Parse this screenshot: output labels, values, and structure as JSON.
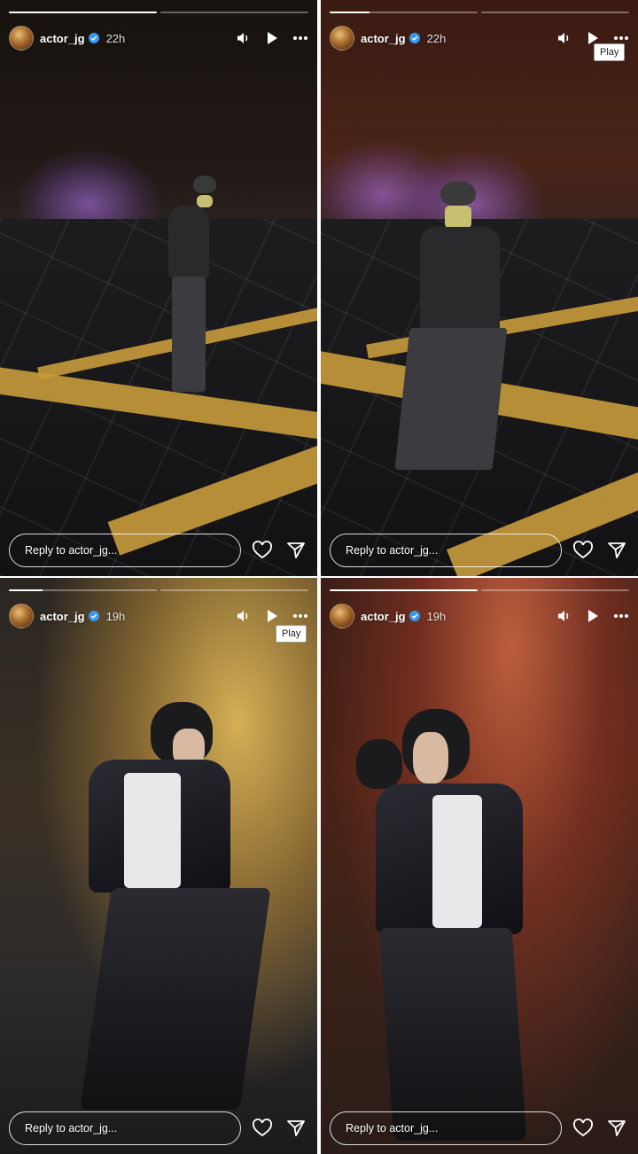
{
  "stories": [
    {
      "username": "actor_jg",
      "time": "22h",
      "reply_placeholder": "Reply to actor_jg...",
      "progress": [
        1.0,
        0.0
      ],
      "tooltip": null
    },
    {
      "username": "actor_jg",
      "time": "22h",
      "reply_placeholder": "Reply to actor_jg...",
      "progress": [
        0.27,
        0.0
      ],
      "tooltip": "Play"
    },
    {
      "username": "actor_jg",
      "time": "19h",
      "reply_placeholder": "Reply to actor_jg...",
      "progress": [
        0.23,
        0.0
      ],
      "tooltip": "Play"
    },
    {
      "username": "actor_jg",
      "time": "19h",
      "reply_placeholder": "Reply to actor_jg...",
      "progress": [
        1.0,
        0.0
      ],
      "tooltip": null
    }
  ],
  "icons": {
    "mute": "speaker-icon",
    "play": "play-icon",
    "more": "more-icon",
    "like": "heart-icon",
    "share": "send-icon",
    "verified": "verified-badge-icon"
  },
  "colors": {
    "overlay_text": "#ffffff",
    "verified_blue": "#3897f0"
  }
}
